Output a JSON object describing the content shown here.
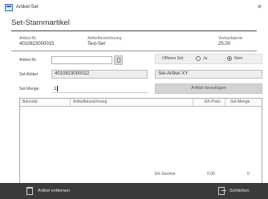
{
  "window": {
    "title": "Artikel-Set",
    "close_glyph": "×",
    "icon": "app-icon"
  },
  "header": {
    "title": "Set-Stammartikel",
    "artikel_nr_label": "Artikel-Nr.",
    "artikel_nr": "4010823000015",
    "bezeichnung_label": "Artikelbezeichnung",
    "bezeichnung": "Test-Set",
    "vk_label": "Verkaufspreis",
    "vk": "25,00"
  },
  "form": {
    "artikel_nr_label": "Artikel-Nr.",
    "artikel_nr_value": "",
    "set_artikel_label": "Set-Artikel",
    "set_artikel_nr": "4010823000022",
    "set_artikel_name": "Set-Artikel XY",
    "offenes_set_label": "Offenes Set:",
    "ja_label": "Ja",
    "nein_label": "Nein",
    "selected": "nein",
    "set_menge_label": "Set-Menge",
    "set_menge_value": "1",
    "add_button": "Artikel hinzufügen"
  },
  "table": {
    "columns": [
      "Barcode",
      "Artikelbezeichnung",
      "EK-Preis",
      "Set-Menge"
    ],
    "rows": []
  },
  "summary": {
    "label": "EK-Summe",
    "ek_sum": "0,00",
    "menge_sum": "0"
  },
  "footer": {
    "remove_label": "Artikel entfernen",
    "close_label": "Schließen"
  }
}
